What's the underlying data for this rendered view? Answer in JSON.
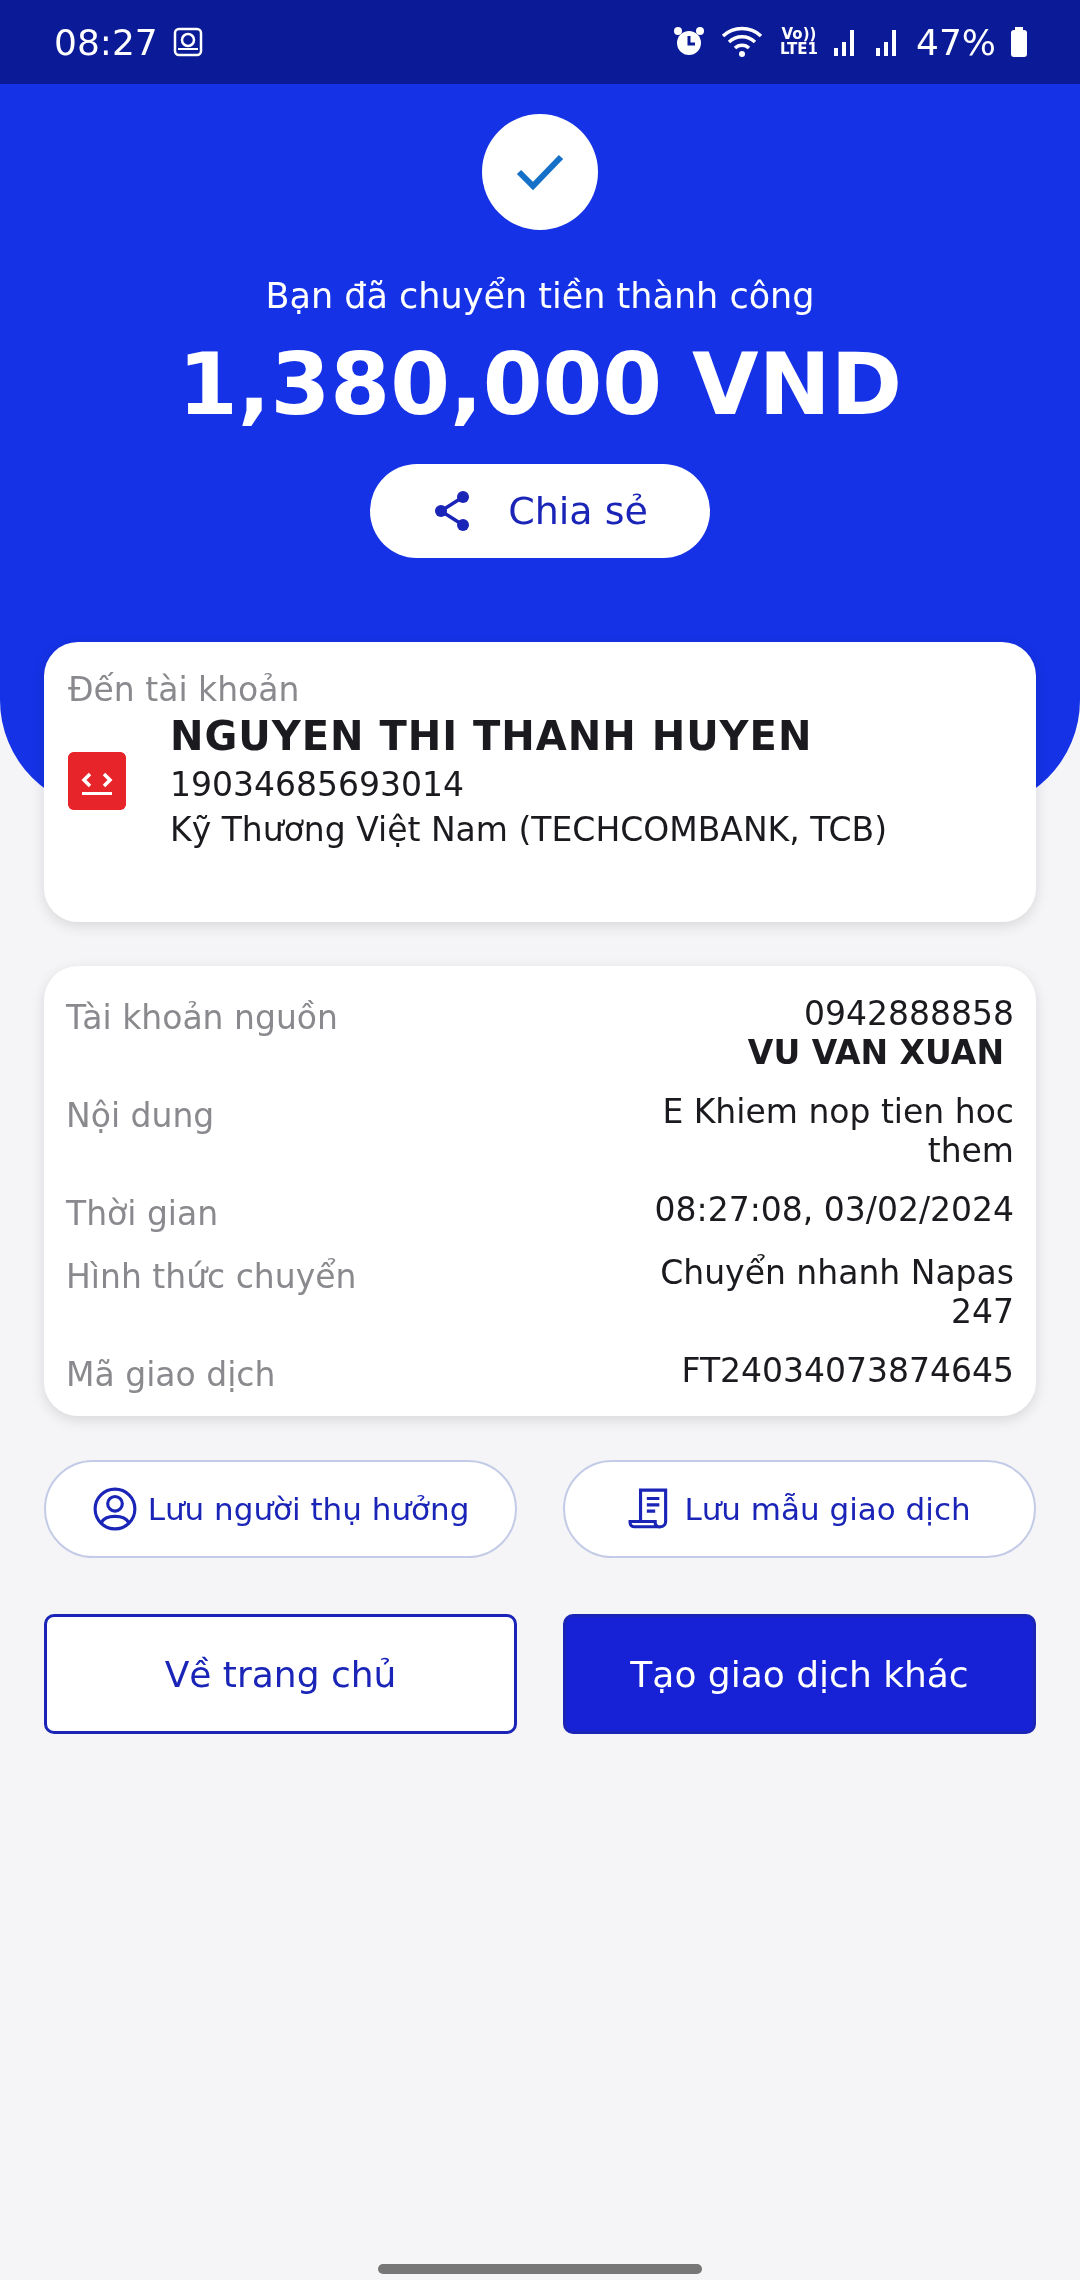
{
  "status_bar": {
    "time": "08:27",
    "network_top": "Vo))",
    "network_bottom": "LTE1",
    "battery": "47%"
  },
  "hero": {
    "message": "Bạn đã chuyển tiền thành công",
    "amount": "1,380,000 VND",
    "share_button": "Chia sẻ"
  },
  "recipient": {
    "label": "Đến tài khoản",
    "name": "NGUYEN THI THANH HUYEN",
    "account": "19034685693014",
    "bank": "Kỹ Thương Việt Nam (TECHCOMBANK, TCB)"
  },
  "details": [
    {
      "label": "Tài khoản nguồn",
      "value": "0942888858",
      "sub_value": "VU VAN XUAN"
    },
    {
      "label": "Nội dung",
      "value": "E Khiem nop tien hoc them"
    },
    {
      "label": "Thời gian",
      "value": "08:27:08, 03/02/2024"
    },
    {
      "label": "Hình thức chuyển",
      "value": "Chuyển nhanh Napas 247"
    },
    {
      "label": "Mã giao dịch",
      "value": "FT24034073874645"
    }
  ],
  "save_actions": [
    {
      "kind": "person",
      "label": "Lưu người thụ hưởng"
    },
    {
      "kind": "receipt",
      "label": "Lưu mẫu giao dịch"
    }
  ],
  "main_actions": [
    {
      "kind": "outline",
      "label": "Về trang chủ"
    },
    {
      "kind": "filled",
      "label": "Tạo giao dịch khác"
    }
  ]
}
